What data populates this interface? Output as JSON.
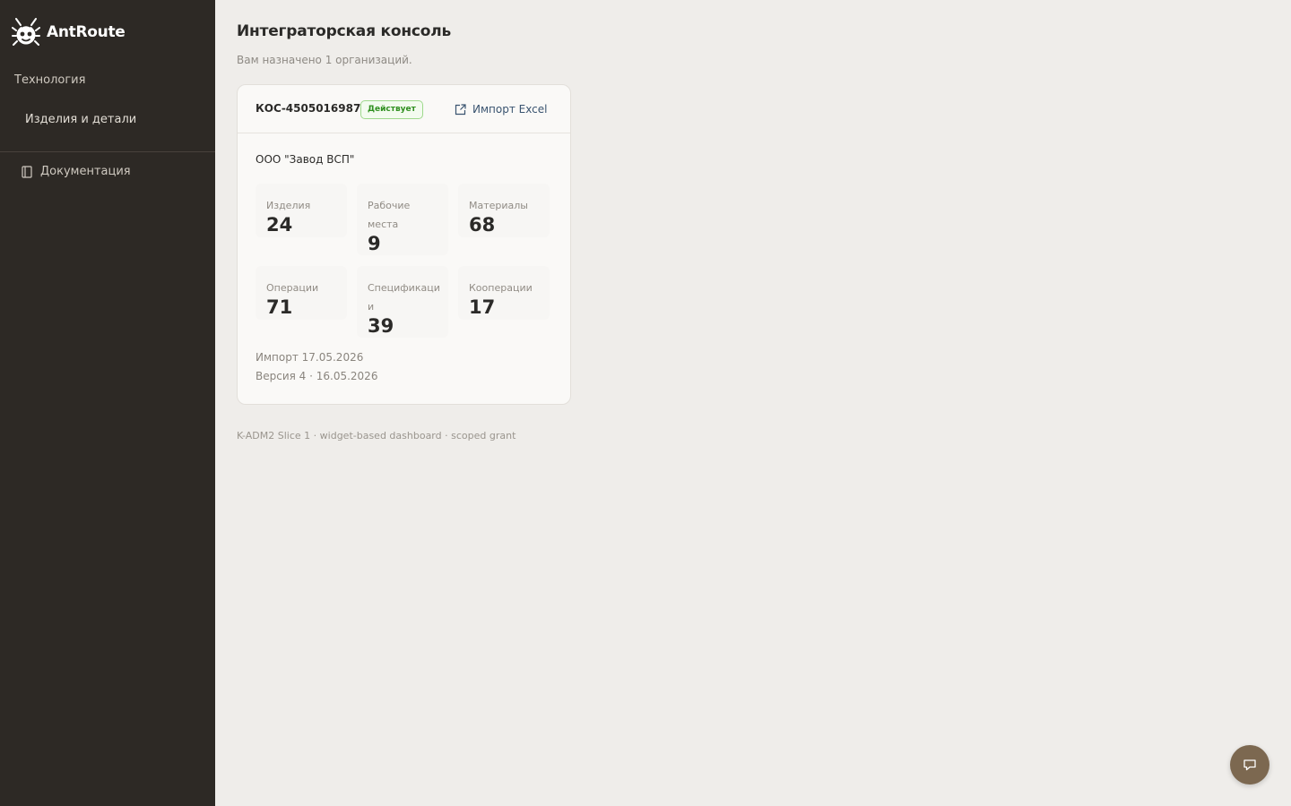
{
  "app": {
    "name": "AntRoute",
    "logo_icon": "ant-icon"
  },
  "sidebar": {
    "section_label": "Технология",
    "items": [
      {
        "label": "Изделия и детали"
      }
    ],
    "docs": {
      "label": "Документация",
      "icon": "book-icon"
    }
  },
  "page": {
    "title": "Интеграторская консоль",
    "subtitle": "Вам назначено 1 организаций."
  },
  "org_card": {
    "code": "КОС-4505016987",
    "status": "Действует",
    "status_color": "#2f8f1f",
    "import_label": "Импорт Excel",
    "import_icon": "external-link-icon",
    "name": "ООО \"Завод ВСП\"",
    "stats": [
      {
        "label": "Изделия",
        "value": "24"
      },
      {
        "label": "Рабочие места",
        "value": "9"
      },
      {
        "label": "Материалы",
        "value": "68"
      },
      {
        "label": "Операции",
        "value": "71"
      },
      {
        "label": "Спецификации",
        "value": "39"
      },
      {
        "label": "Кооперации",
        "value": "17"
      }
    ],
    "import_date": "Импорт 17.05.2026",
    "version": "Версия 4 · 16.05.2026"
  },
  "footer": {
    "note": "K-ADM2 Slice 1 · widget-based dashboard · scoped grant"
  },
  "chat": {
    "icon": "chat-icon"
  },
  "colors": {
    "sidebar_bg": "#2d2925",
    "page_bg": "#efedea",
    "accent": "#7c6850",
    "link": "#3a5470"
  }
}
